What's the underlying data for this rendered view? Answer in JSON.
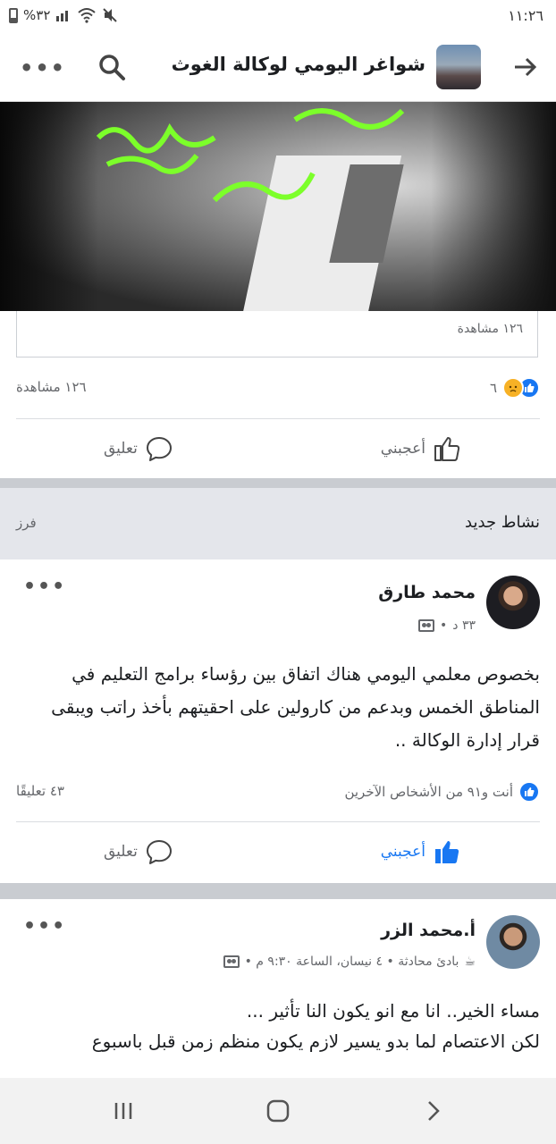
{
  "status_bar": {
    "time": "١١:٢٦",
    "battery": "%٣٢"
  },
  "header": {
    "title": "شواغر اليومي لوكالة الغوث"
  },
  "shared_video": {
    "views": "١٢٦ مشاهدة"
  },
  "post1_footer": {
    "reaction_count": "٦",
    "views": "١٢٦ مشاهدة",
    "like_label": "أعجبني",
    "comment_label": "تعليق"
  },
  "new_activity": {
    "label": "نشاط جديد",
    "sort_label": "فرز"
  },
  "post2": {
    "author": "محمد طارق",
    "time": "٣٣ د",
    "text": "بخصوص معلمي اليومي هناك اتفاق بين رؤساء برامج التعليم في المناطق الخمس وبدعم من كارولين على احقيتهم بأخذ راتب ويبقى قرار إدارة الوكالة ..",
    "reactions_text": "أنت و٩١ من الأشخاص الآخرين",
    "comments_count": "٤٣ تعليقًا",
    "like_label": "أعجبني",
    "comment_label": "تعليق"
  },
  "post3": {
    "author": "أ.محمد الزر",
    "meta": "بادئ محادثة • ٤ نيسان، الساعة ٩:٣٠ م •",
    "text_line1": "مساء الخير.. انا مع انو يكون النا تأثير ...",
    "text_line2": "لكن الاعتصام لما بدو يسير لازم يكون منظم زمن قبل باسبوع"
  },
  "colors": {
    "facebook_blue": "#1877f2",
    "text_secondary": "#65676b",
    "separator_band": "#c9ccd1",
    "video_text_green": "#7cff2a"
  },
  "icons": [
    "back-arrow-icon",
    "search-icon",
    "more-icon",
    "like-icon",
    "comment-icon",
    "sad-reaction-icon",
    "group-icon",
    "recents-icon",
    "home-icon",
    "back-nav-icon",
    "mute-icon",
    "wifi-icon",
    "signal-icon",
    "battery-icon"
  ]
}
